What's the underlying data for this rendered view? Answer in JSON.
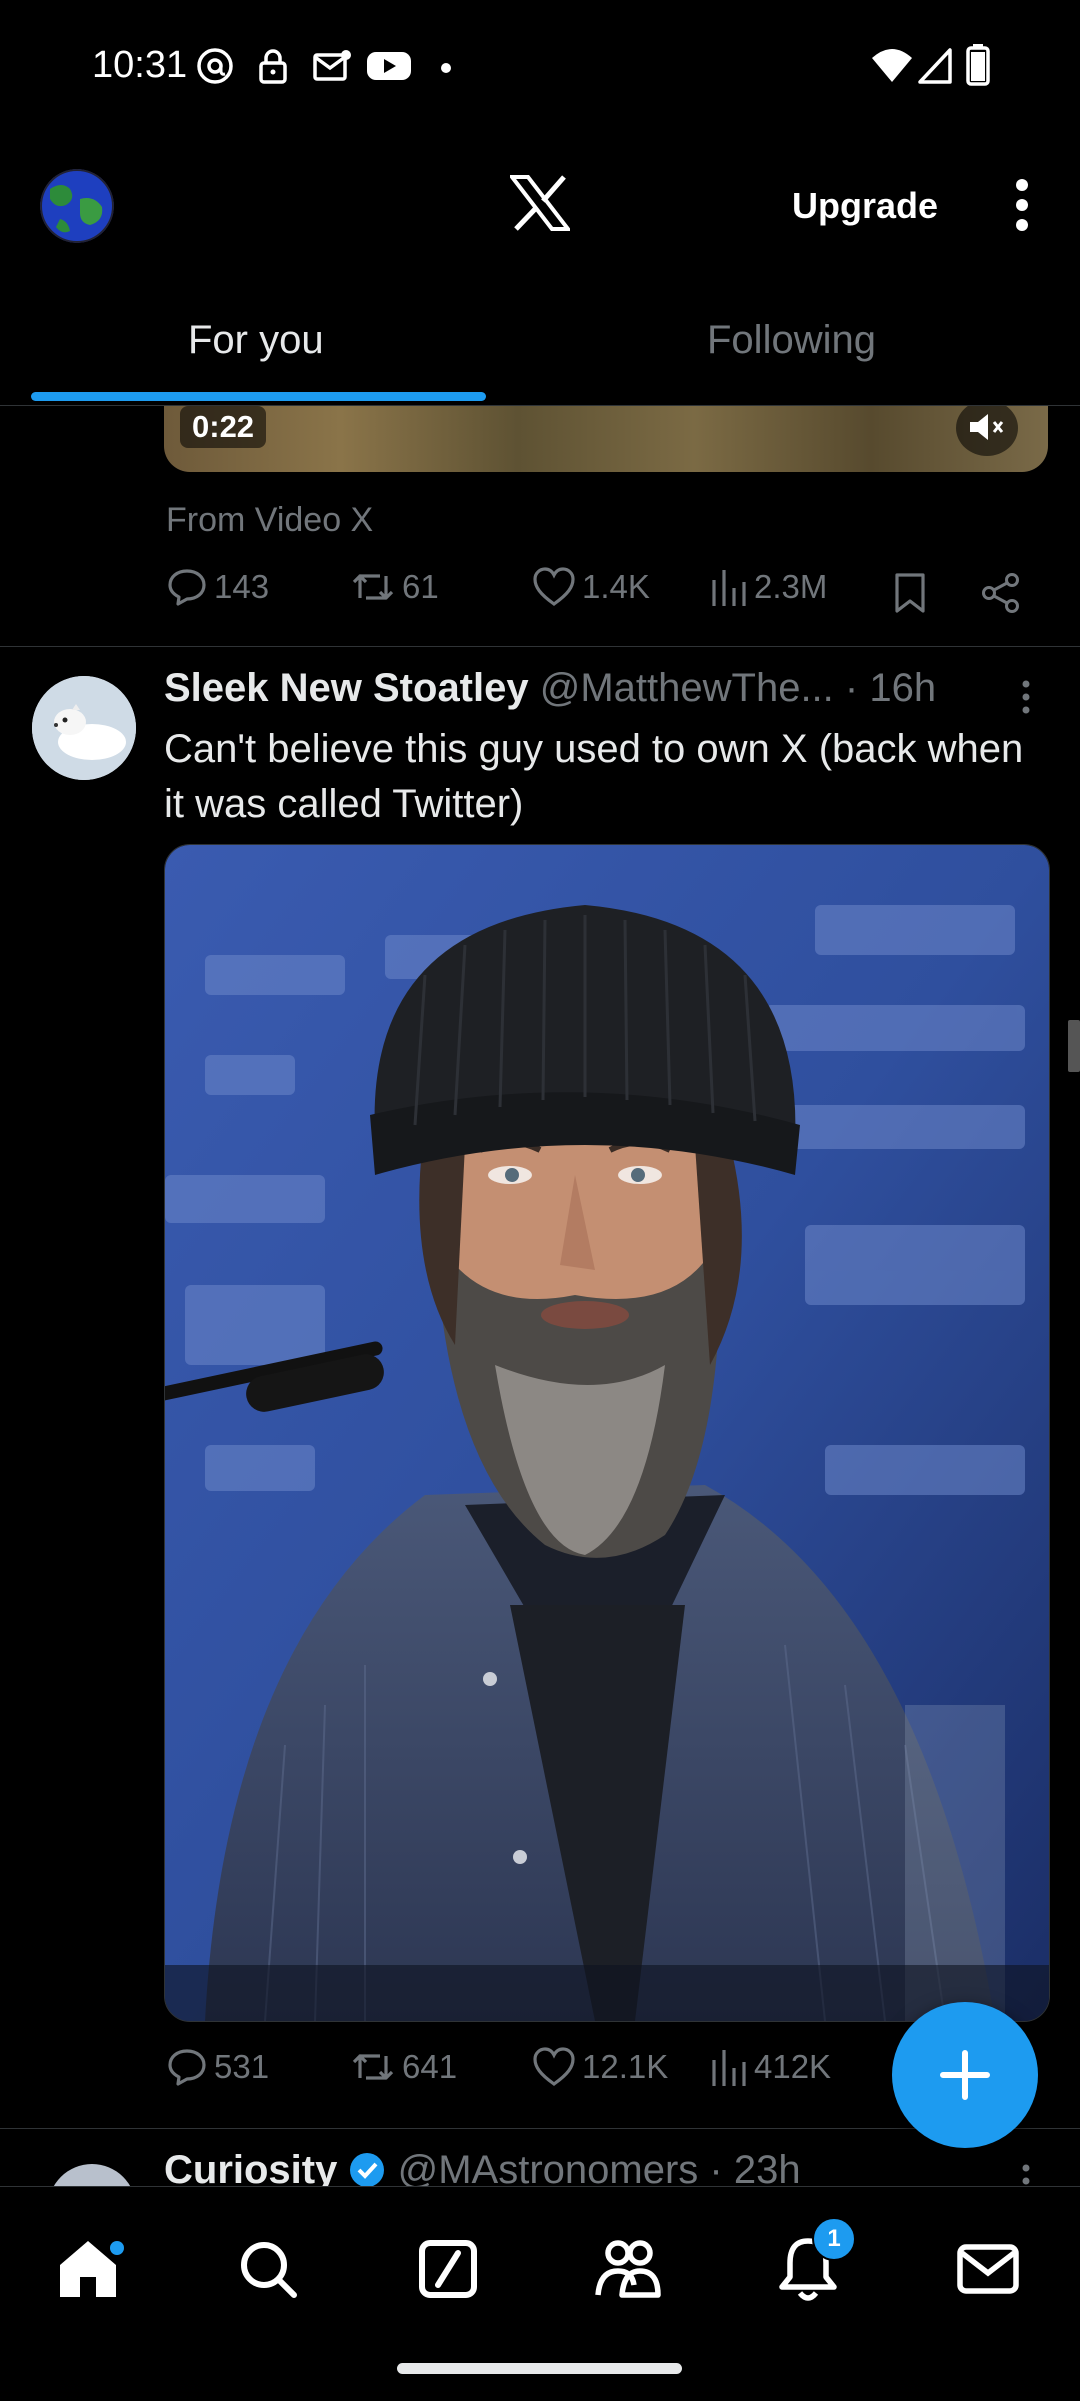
{
  "status_bar": {
    "time": "10:31",
    "icons": [
      "threads-icon",
      "lock-icon",
      "mail-icon",
      "youtube-icon",
      "dot-icon",
      "wifi-icon",
      "signal-icon",
      "battery-icon"
    ]
  },
  "top_bar": {
    "upgrade_label": "Upgrade"
  },
  "tabs": [
    {
      "label": "For you",
      "selected": true
    },
    {
      "label": "Following",
      "selected": false
    }
  ],
  "post1": {
    "video_time": "0:22",
    "from_label": "From Video X",
    "replies": "143",
    "reposts": "61",
    "likes": "1.4K",
    "views": "2.3M"
  },
  "post2": {
    "display_name": "Sleek New Stoatley",
    "handle": "@MatthewThe...",
    "time": "· 16h",
    "text": "Can't believe this guy used to own X (back when it was called Twitter)",
    "replies": "531",
    "reposts": "641",
    "likes": "12.1K",
    "views": "412K"
  },
  "post3": {
    "display_name": "Curiosity",
    "handle": "@MAstronomers",
    "time": "· 23h"
  },
  "bottom_nav": {
    "items": [
      "home-icon",
      "search-icon",
      "grok-icon",
      "communities-icon",
      "notifications-icon",
      "messages-icon"
    ],
    "notifications_count": "1"
  },
  "colors": {
    "accent": "#1d9bf0",
    "background": "#000000",
    "secondary_text": "#71767b"
  }
}
